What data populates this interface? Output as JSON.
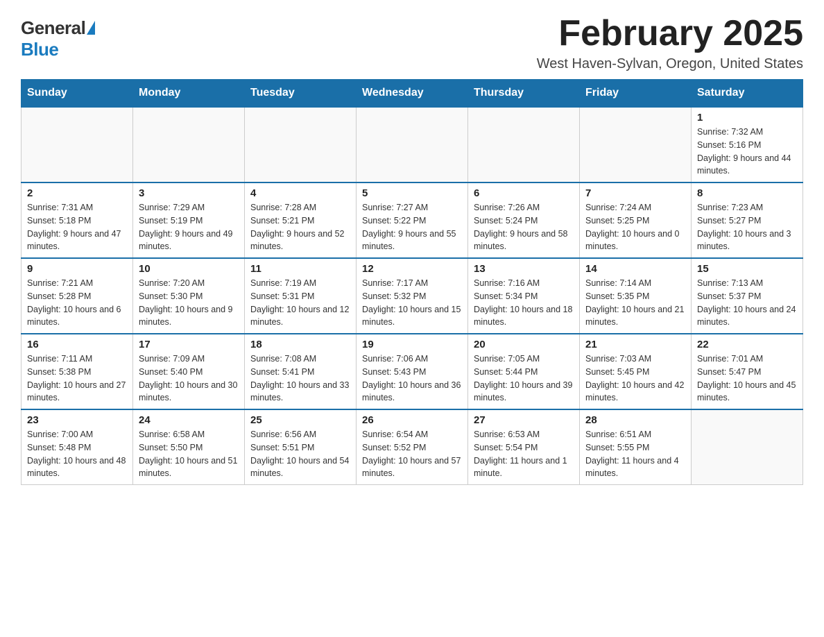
{
  "logo": {
    "general": "General",
    "blue": "Blue"
  },
  "header": {
    "month": "February 2025",
    "location": "West Haven-Sylvan, Oregon, United States"
  },
  "weekdays": [
    "Sunday",
    "Monday",
    "Tuesday",
    "Wednesday",
    "Thursday",
    "Friday",
    "Saturday"
  ],
  "weeks": [
    [
      {
        "day": "",
        "info": ""
      },
      {
        "day": "",
        "info": ""
      },
      {
        "day": "",
        "info": ""
      },
      {
        "day": "",
        "info": ""
      },
      {
        "day": "",
        "info": ""
      },
      {
        "day": "",
        "info": ""
      },
      {
        "day": "1",
        "info": "Sunrise: 7:32 AM\nSunset: 5:16 PM\nDaylight: 9 hours and 44 minutes."
      }
    ],
    [
      {
        "day": "2",
        "info": "Sunrise: 7:31 AM\nSunset: 5:18 PM\nDaylight: 9 hours and 47 minutes."
      },
      {
        "day": "3",
        "info": "Sunrise: 7:29 AM\nSunset: 5:19 PM\nDaylight: 9 hours and 49 minutes."
      },
      {
        "day": "4",
        "info": "Sunrise: 7:28 AM\nSunset: 5:21 PM\nDaylight: 9 hours and 52 minutes."
      },
      {
        "day": "5",
        "info": "Sunrise: 7:27 AM\nSunset: 5:22 PM\nDaylight: 9 hours and 55 minutes."
      },
      {
        "day": "6",
        "info": "Sunrise: 7:26 AM\nSunset: 5:24 PM\nDaylight: 9 hours and 58 minutes."
      },
      {
        "day": "7",
        "info": "Sunrise: 7:24 AM\nSunset: 5:25 PM\nDaylight: 10 hours and 0 minutes."
      },
      {
        "day": "8",
        "info": "Sunrise: 7:23 AM\nSunset: 5:27 PM\nDaylight: 10 hours and 3 minutes."
      }
    ],
    [
      {
        "day": "9",
        "info": "Sunrise: 7:21 AM\nSunset: 5:28 PM\nDaylight: 10 hours and 6 minutes."
      },
      {
        "day": "10",
        "info": "Sunrise: 7:20 AM\nSunset: 5:30 PM\nDaylight: 10 hours and 9 minutes."
      },
      {
        "day": "11",
        "info": "Sunrise: 7:19 AM\nSunset: 5:31 PM\nDaylight: 10 hours and 12 minutes."
      },
      {
        "day": "12",
        "info": "Sunrise: 7:17 AM\nSunset: 5:32 PM\nDaylight: 10 hours and 15 minutes."
      },
      {
        "day": "13",
        "info": "Sunrise: 7:16 AM\nSunset: 5:34 PM\nDaylight: 10 hours and 18 minutes."
      },
      {
        "day": "14",
        "info": "Sunrise: 7:14 AM\nSunset: 5:35 PM\nDaylight: 10 hours and 21 minutes."
      },
      {
        "day": "15",
        "info": "Sunrise: 7:13 AM\nSunset: 5:37 PM\nDaylight: 10 hours and 24 minutes."
      }
    ],
    [
      {
        "day": "16",
        "info": "Sunrise: 7:11 AM\nSunset: 5:38 PM\nDaylight: 10 hours and 27 minutes."
      },
      {
        "day": "17",
        "info": "Sunrise: 7:09 AM\nSunset: 5:40 PM\nDaylight: 10 hours and 30 minutes."
      },
      {
        "day": "18",
        "info": "Sunrise: 7:08 AM\nSunset: 5:41 PM\nDaylight: 10 hours and 33 minutes."
      },
      {
        "day": "19",
        "info": "Sunrise: 7:06 AM\nSunset: 5:43 PM\nDaylight: 10 hours and 36 minutes."
      },
      {
        "day": "20",
        "info": "Sunrise: 7:05 AM\nSunset: 5:44 PM\nDaylight: 10 hours and 39 minutes."
      },
      {
        "day": "21",
        "info": "Sunrise: 7:03 AM\nSunset: 5:45 PM\nDaylight: 10 hours and 42 minutes."
      },
      {
        "day": "22",
        "info": "Sunrise: 7:01 AM\nSunset: 5:47 PM\nDaylight: 10 hours and 45 minutes."
      }
    ],
    [
      {
        "day": "23",
        "info": "Sunrise: 7:00 AM\nSunset: 5:48 PM\nDaylight: 10 hours and 48 minutes."
      },
      {
        "day": "24",
        "info": "Sunrise: 6:58 AM\nSunset: 5:50 PM\nDaylight: 10 hours and 51 minutes."
      },
      {
        "day": "25",
        "info": "Sunrise: 6:56 AM\nSunset: 5:51 PM\nDaylight: 10 hours and 54 minutes."
      },
      {
        "day": "26",
        "info": "Sunrise: 6:54 AM\nSunset: 5:52 PM\nDaylight: 10 hours and 57 minutes."
      },
      {
        "day": "27",
        "info": "Sunrise: 6:53 AM\nSunset: 5:54 PM\nDaylight: 11 hours and 1 minute."
      },
      {
        "day": "28",
        "info": "Sunrise: 6:51 AM\nSunset: 5:55 PM\nDaylight: 11 hours and 4 minutes."
      },
      {
        "day": "",
        "info": ""
      }
    ]
  ]
}
